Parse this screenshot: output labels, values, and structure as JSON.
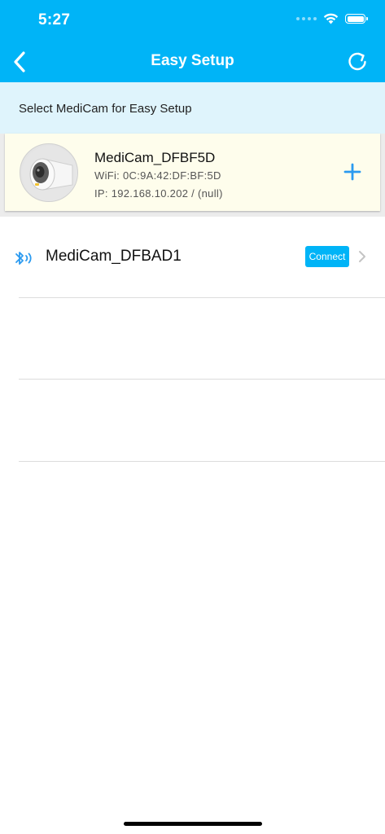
{
  "status_bar": {
    "time": "5:27"
  },
  "nav": {
    "title": "Easy Setup",
    "back_icon": "chevron-left-icon",
    "refresh_icon": "refresh-icon"
  },
  "subheader": {
    "text": "Select MediCam for Easy Setup"
  },
  "found_device": {
    "name": "MediCam_DFBF5D",
    "wifi": "WiFi: 0C:9A:42:DF:BF:5D",
    "ip": "IP: 192.168.10.202 / (null)",
    "add_icon": "plus-icon"
  },
  "bluetooth_devices": [
    {
      "name": "MediCam_DFBAD1",
      "connect_label": "Connect",
      "icon": "bluetooth-icon"
    }
  ],
  "colors": {
    "accent": "#00b4f7",
    "subheader_bg": "#dff4fc",
    "card_bg": "#fefdec",
    "plus": "#2a9af0"
  }
}
